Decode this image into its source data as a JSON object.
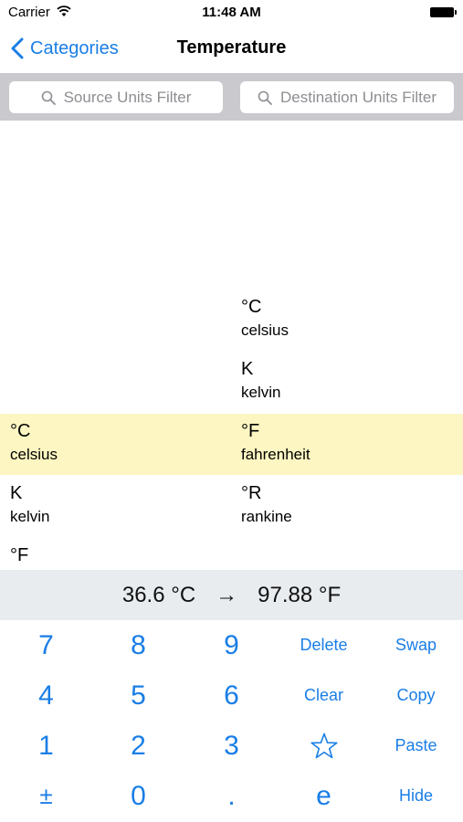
{
  "status_bar": {
    "carrier": "Carrier",
    "time": "11:48 AM"
  },
  "nav": {
    "back_label": "Categories",
    "title": "Temperature"
  },
  "search": {
    "source_placeholder": "Source Units Filter",
    "destination_placeholder": "Destination Units Filter"
  },
  "source_units": [
    {
      "symbol": "°C",
      "name": "celsius"
    },
    {
      "symbol": "K",
      "name": "kelvin"
    },
    {
      "symbol": "°F",
      "name": ""
    }
  ],
  "destination_units": [
    {
      "symbol": "°C",
      "name": "celsius"
    },
    {
      "symbol": "K",
      "name": "kelvin"
    },
    {
      "symbol": "°F",
      "name": "fahrenheit"
    },
    {
      "symbol": "°R",
      "name": "rankine"
    }
  ],
  "result": {
    "input": "36.6 °C",
    "arrow": "→",
    "output": "97.88 °F"
  },
  "keypad": {
    "k7": "7",
    "k8": "8",
    "k9": "9",
    "delete": "Delete",
    "swap": "Swap",
    "k4": "4",
    "k5": "5",
    "k6": "6",
    "clear": "Clear",
    "copy": "Copy",
    "k1": "1",
    "k2": "2",
    "k3": "3",
    "star_icon": "star-icon",
    "paste": "Paste",
    "plusminus": "±",
    "k0": "0",
    "dot": ".",
    "e": "e",
    "hide": "Hide"
  },
  "colors": {
    "accent": "#1a7ee6",
    "selection": "#fdf6c2",
    "result_bg": "#e8ecef",
    "search_bar_bg": "#c9c9ce"
  }
}
